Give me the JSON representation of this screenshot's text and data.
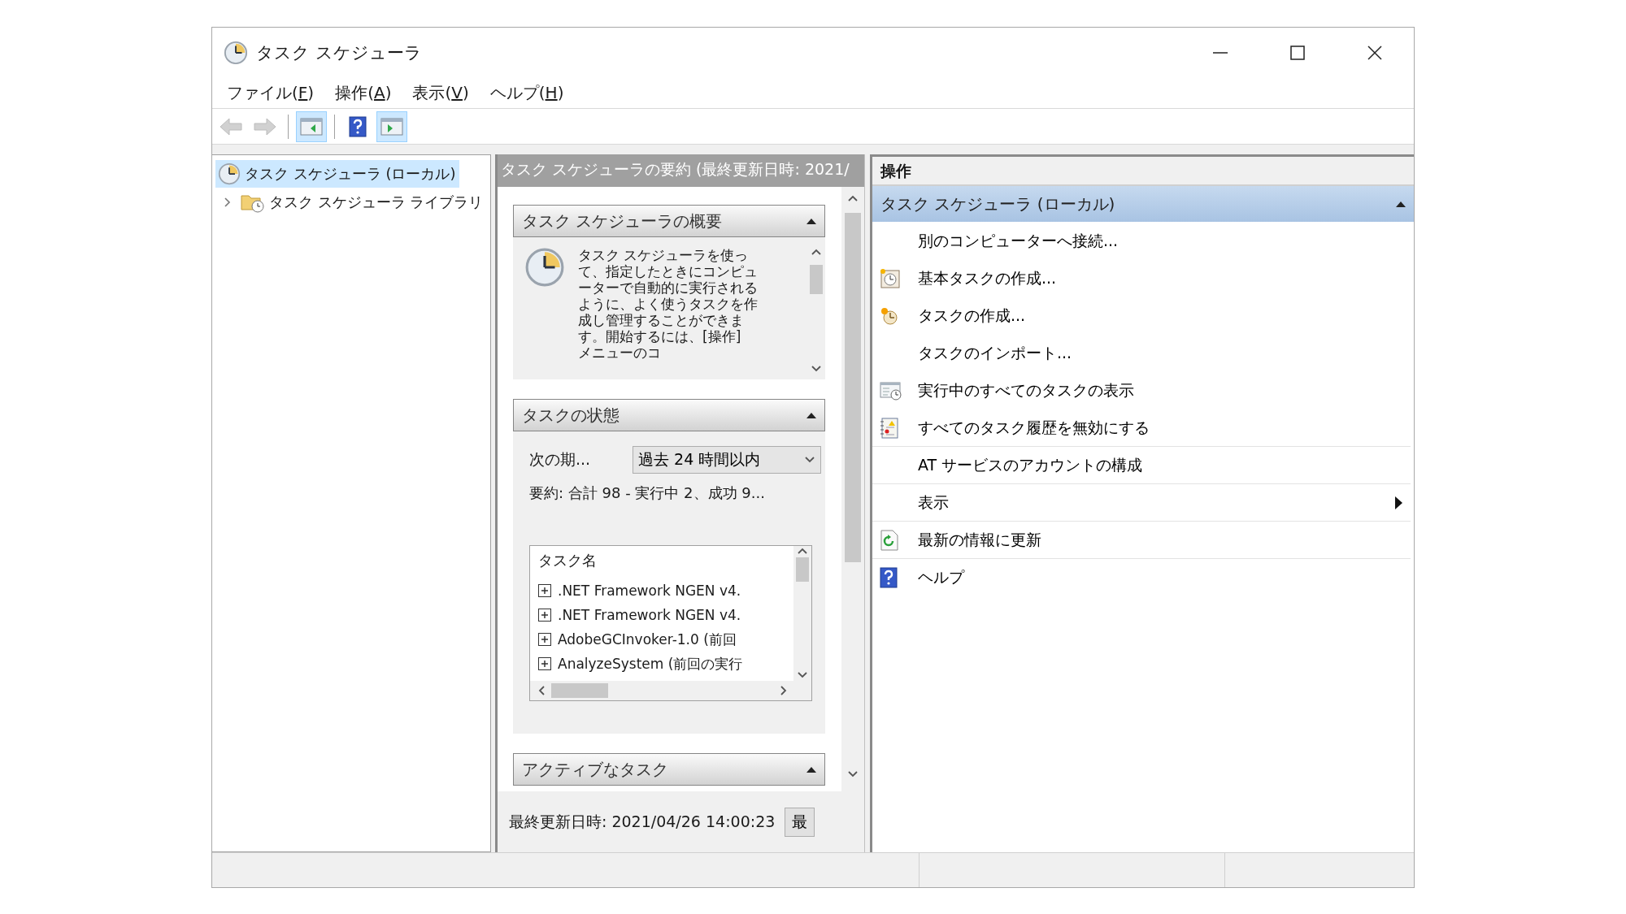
{
  "window": {
    "title": "タスク スケジューラ"
  },
  "menu": [
    {
      "before": "ファイル(",
      "key": "F",
      "after": ")"
    },
    {
      "before": "操作(",
      "key": "A",
      "after": ")"
    },
    {
      "before": "表示(",
      "key": "V",
      "after": ")"
    },
    {
      "before": "ヘルプ(",
      "key": "H",
      "after": ")"
    }
  ],
  "toolbar": [
    {
      "kind": "back",
      "disabled": true,
      "pressed": false
    },
    {
      "kind": "forward",
      "disabled": true,
      "pressed": false
    },
    {
      "kind": "tree-pane",
      "disabled": false,
      "pressed": true
    },
    {
      "kind": "help",
      "disabled": false,
      "pressed": false
    },
    {
      "kind": "action-pane",
      "disabled": false,
      "pressed": true
    }
  ],
  "tree": [
    {
      "label": "タスク スケジューラ (ローカル)",
      "selected": true,
      "children": [
        {
          "label": "タスク スケジューラ ライブラリ",
          "selected": false,
          "expanded": false
        }
      ]
    }
  ],
  "summary_pane": {
    "title": "タスク スケジューラの要約 (最終更新日時: 2021/",
    "sections": [
      {
        "kind": "overview",
        "title": "タスク スケジューラの概要",
        "expanded": true,
        "text": "タスク スケジューラを使って、指定したときにコンピューターで自動的に実行されるように、よく使うタスクを作成し管理することができます。開始するには、[操作] メニューのコ"
      },
      {
        "kind": "status",
        "title": "タスクの状態",
        "expanded": true,
        "period_label": "次の期...",
        "period_value": "過去 24 時間以内",
        "summary": "要約: 合計 98 - 実行中 2、成功 9...",
        "list": {
          "header": "タスク名",
          "rows": [
            {
              "name": ".NET Framework NGEN v4.",
              "expanded": false
            },
            {
              "name": ".NET Framework NGEN v4.",
              "expanded": false
            },
            {
              "name": "AdobeGCInvoker-1.0 (前回",
              "expanded": false
            },
            {
              "name": "AnalyzeSystem (前回の実行",
              "expanded": false
            }
          ]
        }
      },
      {
        "kind": "plain",
        "title": "アクティブなタスク",
        "expanded": true
      }
    ],
    "footer": {
      "text": "最終更新日時: 2021/04/26 14:00:23",
      "button": "最"
    }
  },
  "actions_pane": {
    "title": "操作",
    "group": {
      "label": "タスク スケジューラ (ローカル)",
      "expanded": true
    },
    "items": [
      {
        "kind": "plain",
        "label": "別のコンピューターへ接続...",
        "divider_above": false,
        "submenu": false
      },
      {
        "kind": "basic-task",
        "label": "基本タスクの作成...",
        "divider_above": false,
        "submenu": false
      },
      {
        "kind": "create-task",
        "label": "タスクの作成...",
        "divider_above": false,
        "submenu": false
      },
      {
        "kind": "plain",
        "label": "タスクのインポート...",
        "divider_above": false,
        "submenu": false
      },
      {
        "kind": "running-tasks",
        "label": "実行中のすべてのタスクの表示",
        "divider_above": false,
        "submenu": false
      },
      {
        "kind": "history",
        "label": "すべてのタスク履歴を無効にする",
        "divider_above": false,
        "submenu": false
      },
      {
        "kind": "plain",
        "label": "AT サービスのアカウントの構成",
        "divider_above": true,
        "submenu": false
      },
      {
        "kind": "plain",
        "label": "表示",
        "divider_above": true,
        "submenu": true
      },
      {
        "kind": "refresh",
        "label": "最新の情報に更新",
        "divider_above": true,
        "submenu": false
      },
      {
        "kind": "help",
        "label": "ヘルプ",
        "divider_above": true,
        "submenu": false
      }
    ]
  }
}
